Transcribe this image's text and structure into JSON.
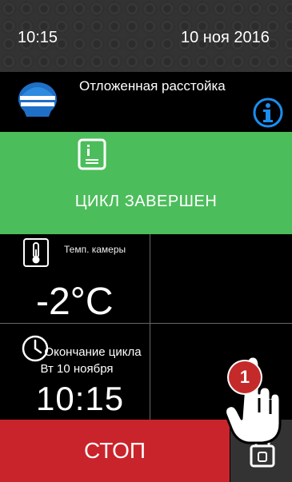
{
  "status_bar": {
    "time": "10:15",
    "date": "10 ноя 2016"
  },
  "program": {
    "name": "Отложенная расстойка",
    "icon": "proofing-icon"
  },
  "status_panel": {
    "text": "ЦИКЛ ЗАВЕРШЕН",
    "color": "#4cbd5b",
    "icon": "recipe-icon"
  },
  "chamber": {
    "label": "Темп. камеры",
    "value": "-2°C",
    "icon": "thermometer-icon"
  },
  "cycle_end": {
    "label": "Окончание цикла Вт 10 ноября",
    "time": "10:15",
    "icon": "clock-icon"
  },
  "actions": {
    "stop_label": "СТОП",
    "stop_color": "#c9242b",
    "lock_icon": "lock-icon"
  },
  "tutorial": {
    "step": "1",
    "badge_color": "#c42a2a"
  }
}
